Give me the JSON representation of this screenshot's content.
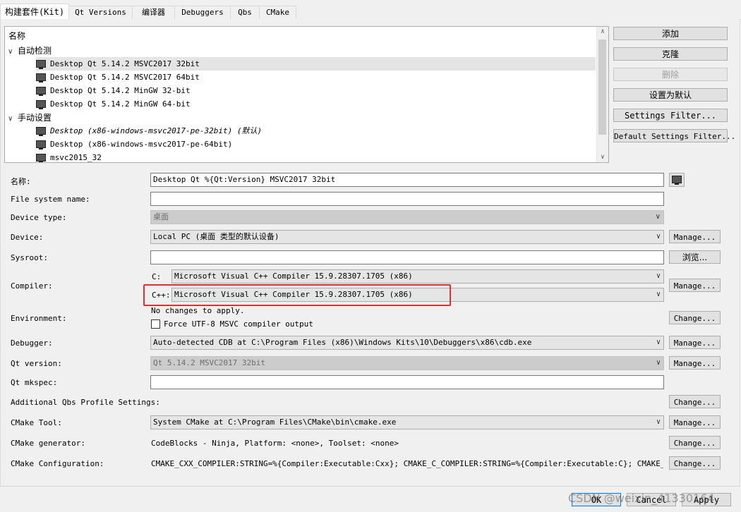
{
  "tabs": [
    "构建套件(Kit)",
    "Qt Versions",
    "编译器",
    "Debuggers",
    "Qbs",
    "CMake"
  ],
  "kits_tree": {
    "header": "名称",
    "groups": [
      {
        "label": "自动检测",
        "kits": [
          "Desktop Qt 5.14.2 MSVC2017 32bit",
          "Desktop Qt 5.14.2 MSVC2017 64bit",
          "Desktop Qt 5.14.2 MinGW 32-bit",
          "Desktop Qt 5.14.2 MinGW 64-bit"
        ]
      },
      {
        "label": "手动设置",
        "kits": [
          "Desktop (x86-windows-msvc2017-pe-32bit) (默认)",
          "Desktop (x86-windows-msvc2017-pe-64bit)",
          "msvc2015_32"
        ]
      }
    ],
    "selected": "Desktop Qt 5.14.2 MSVC2017 32bit"
  },
  "side_buttons": {
    "add": "添加",
    "clone": "克隆",
    "remove": "删除",
    "set_default": "设置为默认",
    "settings_filter": "Settings Filter...",
    "default_settings_filter": "Default Settings Filter..."
  },
  "form": {
    "name_label": "名称:",
    "name_value": "Desktop Qt %{Qt:Version} MSVC2017 32bit",
    "fs_label": "File system name:",
    "fs_value": "",
    "device_type_label": "Device type:",
    "device_type_value": "桌面",
    "device_label": "Device:",
    "device_value": "Local PC (桌面 类型的默认设备)",
    "device_manage": "Manage...",
    "sysroot_label": "Sysroot:",
    "sysroot_value": "",
    "sysroot_browse": "浏览...",
    "compiler_label": "Compiler:",
    "compiler_c_label": "C:",
    "compiler_c_value": "Microsoft Visual C++ Compiler 15.9.28307.1705 (x86)",
    "compiler_cpp_label": "C++:",
    "compiler_cpp_value": "Microsoft Visual C++ Compiler 15.9.28307.1705 (x86)",
    "compiler_manage": "Manage...",
    "env_label": "Environment:",
    "env_value": "No changes to apply.",
    "env_checkbox": "Force UTF-8 MSVC compiler output",
    "env_change": "Change...",
    "debugger_label": "Debugger:",
    "debugger_value": "Auto-detected CDB at C:\\Program Files (x86)\\Windows Kits\\10\\Debuggers\\x86\\cdb.exe",
    "debugger_manage": "Manage...",
    "qt_label": "Qt version:",
    "qt_value": "Qt 5.14.2 MSVC2017 32bit",
    "qt_manage": "Manage...",
    "mkspec_label": "Qt mkspec:",
    "mkspec_value": "",
    "qbs_label": "Additional Qbs Profile Settings:",
    "qbs_change": "Change...",
    "cmake_tool_label": "CMake Tool:",
    "cmake_tool_value": "System CMake at C:\\Program Files\\CMake\\bin\\cmake.exe",
    "cmake_tool_manage": "Manage...",
    "cmake_gen_label": "CMake generator:",
    "cmake_gen_value": "CodeBlocks - Ninja, Platform: <none>, Toolset: <none>",
    "cmake_gen_change": "Change...",
    "cmake_cfg_label": "CMake Configuration:",
    "cmake_cfg_value": "CMAKE_CXX_COMPILER:STRING=%{Compiler:Executable:Cxx}; CMAKE_C_COMPILER:STRING=%{Compiler:Executable:C}; CMAKE_PREFIX_PA…",
    "cmake_cfg_change": "Change..."
  },
  "footer": {
    "ok": "OK",
    "cancel": "Cancel",
    "apply": "Apply"
  },
  "watermark": "CSDN @weixin_41330164"
}
